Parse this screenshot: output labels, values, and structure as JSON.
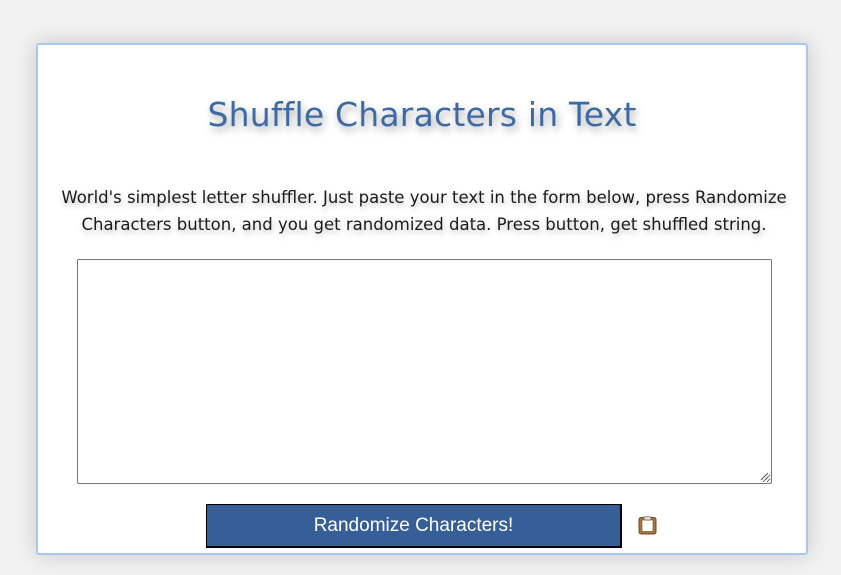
{
  "page": {
    "title": "Shuffle Characters in Text",
    "description": "World's simplest letter shuffler. Just paste your text in the form below, press Randomize Characters button, and you get randomized data. Press button, get shuffled string."
  },
  "form": {
    "textarea_value": "",
    "button_label": "Randomize Characters!",
    "clipboard_icon": "clipboard-icon"
  },
  "colors": {
    "title": "#3d6aa3",
    "button_bg": "#365e97",
    "card_border": "#a8c8ef",
    "clipboard_icon": "#a8743a"
  }
}
